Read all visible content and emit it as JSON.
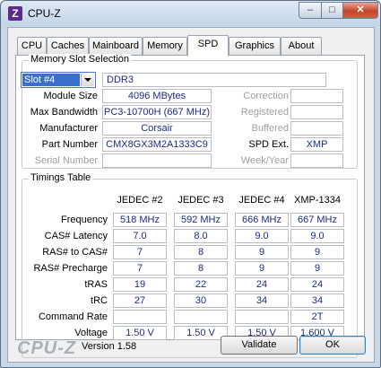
{
  "window": {
    "title": "CPU-Z",
    "icon_letter": "Z",
    "controls": {
      "minimize": "–",
      "maximize": "□",
      "close": "✕"
    }
  },
  "tabs": [
    "CPU",
    "Caches",
    "Mainboard",
    "Memory",
    "SPD",
    "Graphics",
    "About"
  ],
  "active_tab": "SPD",
  "memory_slot": {
    "legend": "Memory Slot Selection",
    "slot_selected": "Slot #4",
    "type": "DDR3",
    "labels": {
      "module_size": "Module Size",
      "max_bandwidth": "Max Bandwidth",
      "manufacturer": "Manufacturer",
      "part_number": "Part Number",
      "serial_number": "Serial Number",
      "correction": "Correction",
      "registered": "Registered",
      "buffered": "Buffered",
      "spd_ext": "SPD Ext.",
      "week_year": "Week/Year"
    },
    "values": {
      "module_size": "4096 MBytes",
      "max_bandwidth": "PC3-10700H (667 MHz)",
      "manufacturer": "Corsair",
      "part_number": "CMX8GX3M2A1333C9",
      "serial_number": "",
      "correction": "",
      "registered": "",
      "buffered": "",
      "spd_ext": "XMP",
      "week_year": ""
    }
  },
  "timings": {
    "legend": "Timings Table",
    "columns": [
      "JEDEC #2",
      "JEDEC #3",
      "JEDEC #4",
      "XMP-1334"
    ],
    "rows": [
      {
        "label": "Frequency",
        "values": [
          "518 MHz",
          "592 MHz",
          "666 MHz",
          "667 MHz"
        ]
      },
      {
        "label": "CAS# Latency",
        "values": [
          "7.0",
          "8.0",
          "9.0",
          "9.0"
        ]
      },
      {
        "label": "RAS# to CAS#",
        "values": [
          "7",
          "8",
          "9",
          "9"
        ]
      },
      {
        "label": "RAS# Precharge",
        "values": [
          "7",
          "8",
          "9",
          "9"
        ]
      },
      {
        "label": "tRAS",
        "values": [
          "19",
          "22",
          "24",
          "24"
        ]
      },
      {
        "label": "tRC",
        "values": [
          "27",
          "30",
          "34",
          "34"
        ]
      },
      {
        "label": "Command Rate",
        "values": [
          "",
          "",
          "",
          "2T"
        ]
      },
      {
        "label": "Voltage",
        "values": [
          "1.50 V",
          "1.50 V",
          "1.50 V",
          "1.600 V"
        ]
      }
    ]
  },
  "footer": {
    "logo": "CPU-Z",
    "version": "Version 1.58",
    "validate": "Validate",
    "ok": "OK"
  }
}
